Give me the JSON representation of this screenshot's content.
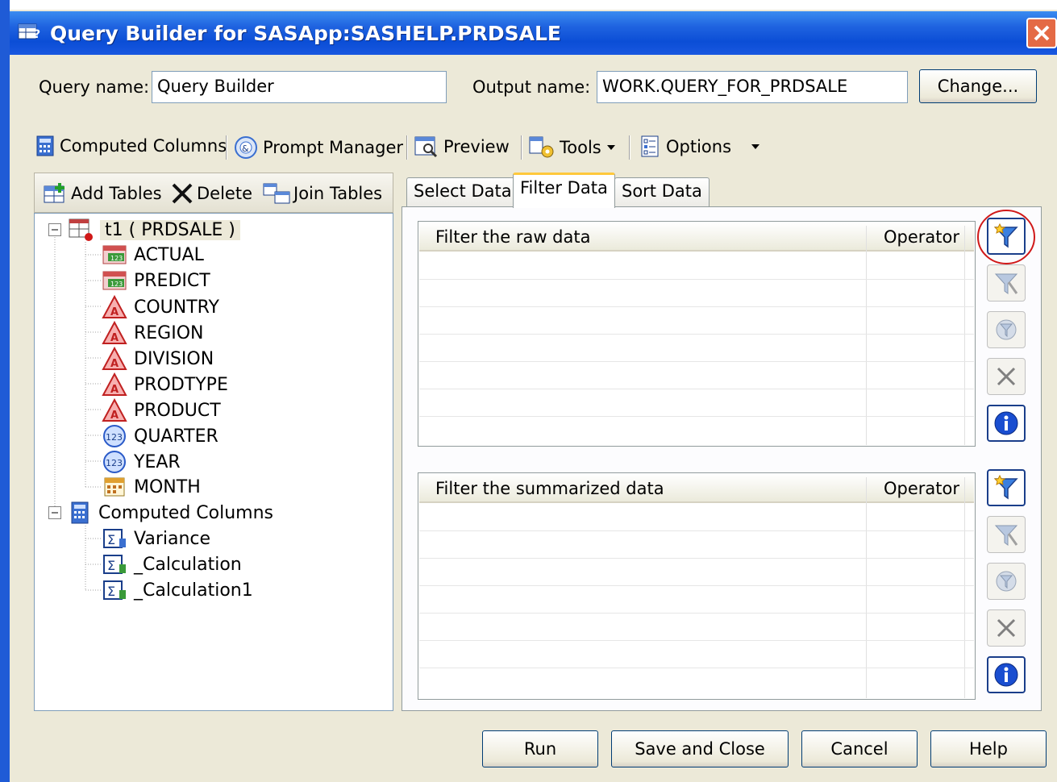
{
  "window": {
    "title": "Query Builder for SASApp:SASHELP.PRDSALE"
  },
  "query_name": {
    "label": "Query name:",
    "value": "Query Builder"
  },
  "output_name": {
    "label": "Output name:",
    "value": "WORK.QUERY_FOR_PRDSALE"
  },
  "change_button": "Change...",
  "toolbar": {
    "computed_columns": "Computed Columns",
    "prompt_manager": "Prompt Manager",
    "preview": "Preview",
    "tools": "Tools",
    "options": "Options"
  },
  "left_toolbar": {
    "add_tables": "Add Tables",
    "delete": "Delete",
    "join_tables": "Join Tables"
  },
  "tree": {
    "table": "t1 ( PRDSALE )",
    "columns": [
      {
        "label": "ACTUAL",
        "icon": "numeric-column-icon"
      },
      {
        "label": "PREDICT",
        "icon": "numeric-column-icon"
      },
      {
        "label": "COUNTRY",
        "icon": "character-column-icon"
      },
      {
        "label": "REGION",
        "icon": "character-column-icon"
      },
      {
        "label": "DIVISION",
        "icon": "character-column-icon"
      },
      {
        "label": "PRODTYPE",
        "icon": "character-column-icon"
      },
      {
        "label": "PRODUCT",
        "icon": "character-column-icon"
      },
      {
        "label": "QUARTER",
        "icon": "number-icon"
      },
      {
        "label": "YEAR",
        "icon": "number-icon"
      },
      {
        "label": "MONTH",
        "icon": "date-icon"
      }
    ],
    "computed": "Computed Columns",
    "computed_items": [
      "Variance",
      "_Calculation",
      "_Calculation1"
    ]
  },
  "tabs": [
    "Select Data",
    "Filter Data",
    "Sort Data"
  ],
  "active_tab": "Filter Data",
  "raw_grid": {
    "col1": "Filter the raw data",
    "col2": "Operator"
  },
  "summary_grid": {
    "col1": "Filter the summarized data",
    "col2": "Operator"
  },
  "footer": {
    "run": "Run",
    "save_close": "Save and Close",
    "cancel": "Cancel",
    "help": "Help"
  },
  "colors": {
    "titlebar": "#0b4ed6",
    "dialog": "#ece9d8",
    "highlight_circle": "#d01818"
  }
}
